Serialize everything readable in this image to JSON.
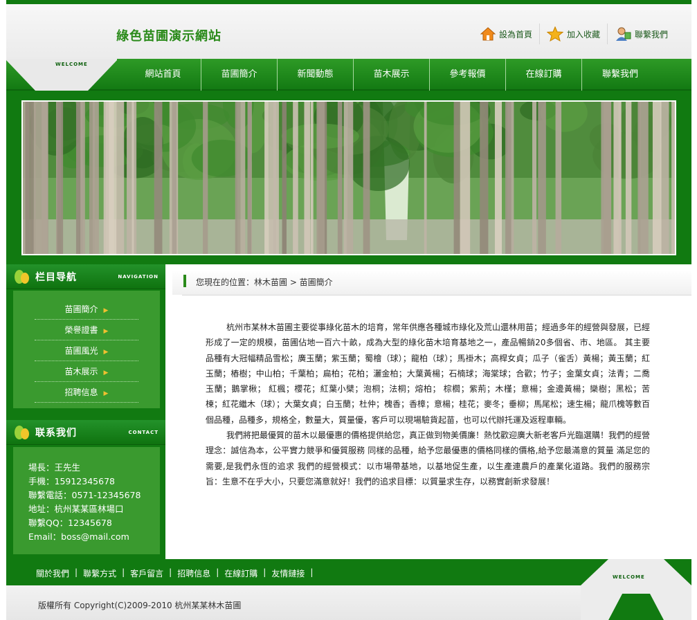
{
  "header": {
    "site_title": "綠色苗圃演示網站",
    "welcome": "WELCOME",
    "links": [
      {
        "icon": "home-icon",
        "label": "設為首頁"
      },
      {
        "icon": "star-icon",
        "label": "加入收藏"
      },
      {
        "icon": "contact-person-icon",
        "label": "聯繫我們"
      }
    ]
  },
  "nav": {
    "items": [
      "網站首頁",
      "苗圃簡介",
      "新聞動態",
      "苗木展示",
      "參考報價",
      "在線訂購",
      "聯繫我們"
    ]
  },
  "sidebar": {
    "nav_title": "栏目导航",
    "nav_title_en": "NAVIGATION",
    "menu": [
      "苗圃簡介",
      "榮譽證書",
      "苗圃風光",
      "苗木展示",
      "招聘信息"
    ],
    "arrow": "▶",
    "contact_title": "联系我们",
    "contact_title_en": "CONTACT",
    "contact_lines": [
      "場長：王先生",
      "手機：15912345678",
      "聯繫電話：0571-12345678",
      "地址：杭州某某區林場口",
      "聯繫QQ：12345678",
      "Email：boss@mail.com"
    ]
  },
  "main": {
    "breadcrumb": "您現在的位置：林木苗圃 > 苗圃簡介",
    "paragraphs": [
      "杭州市某林木苗圃主要從事綠化苗木的培育，常年供應各種城市綠化及荒山還林用苗；經過多年的經營與發展，已經形成了一定的規模，苗圃佔地一百六十畝，成為大型的綠化苗木培育基地之一，產品暢銷20多個省、市、地區。 其主要品種有大冠幅精品雪松；廣玉蘭；紫玉蘭；蜀檜（球）；龍柏（球）；馬褂木；高桿女貞；瓜子（雀舌）黃楊；黃玉蘭；紅玉蘭；樁樹；中山柏；千葉柏；扁柏；花柏；灑金柏；大葉黃楊；石楠球；海棠球；合歡；竹子；金葉女貞；法青；二喬玉蘭；鵝掌楸； 紅楓；櫻花；紅葉小檗；泡桐；法桐；熔柏； 棕櫚；紫荊；木槿；意楊；金邊黃楊；欒樹；黑松；苦楝；紅花繼木（球）；大葉女貞；白玉蘭；杜仲；槐香；香樟；意楊；桂花；麥冬；垂柳；馬尾松；速生楊；龍爪槐等數百個品種，品種多，規格全，數量大，質量優，客戶可以現場驗貨起苗，也可以代辦托運及返程車輛。",
      "我們將把最優質的苗木以最優惠的價格提供給您，真正做到物美價廉！熱忱歡迎廣大新老客戶光臨選購！我們的經營理念：誠信為本，公平實力競爭和優質服務 同樣的品種，給予您最優惠的價格同樣的價格,給予您最滿意的質量 滿足您的需要,是我們永恆的追求 我們的經營模式：以市場帶基地，以基地促生產，以生產連農戶的產業化道路。我們的服務宗旨：生意不在乎大小，只要您滿意就好！我們的追求目標：以質量求生存，以務實創新求發展！"
    ]
  },
  "footer": {
    "links": [
      "關於我們",
      "聯繫方式",
      "客戶留言",
      "招聘信息",
      "在線訂購",
      "友情鏈接"
    ],
    "separator": "|",
    "welcome": "WELCOME",
    "copyright": "版權所有 Copyright(C)2009-2010 杭州某某林木苗圃"
  },
  "colors": {
    "brand_green": "#117a11",
    "panel_green": "#3a9a2f",
    "title_green": "#2a8a1a"
  }
}
